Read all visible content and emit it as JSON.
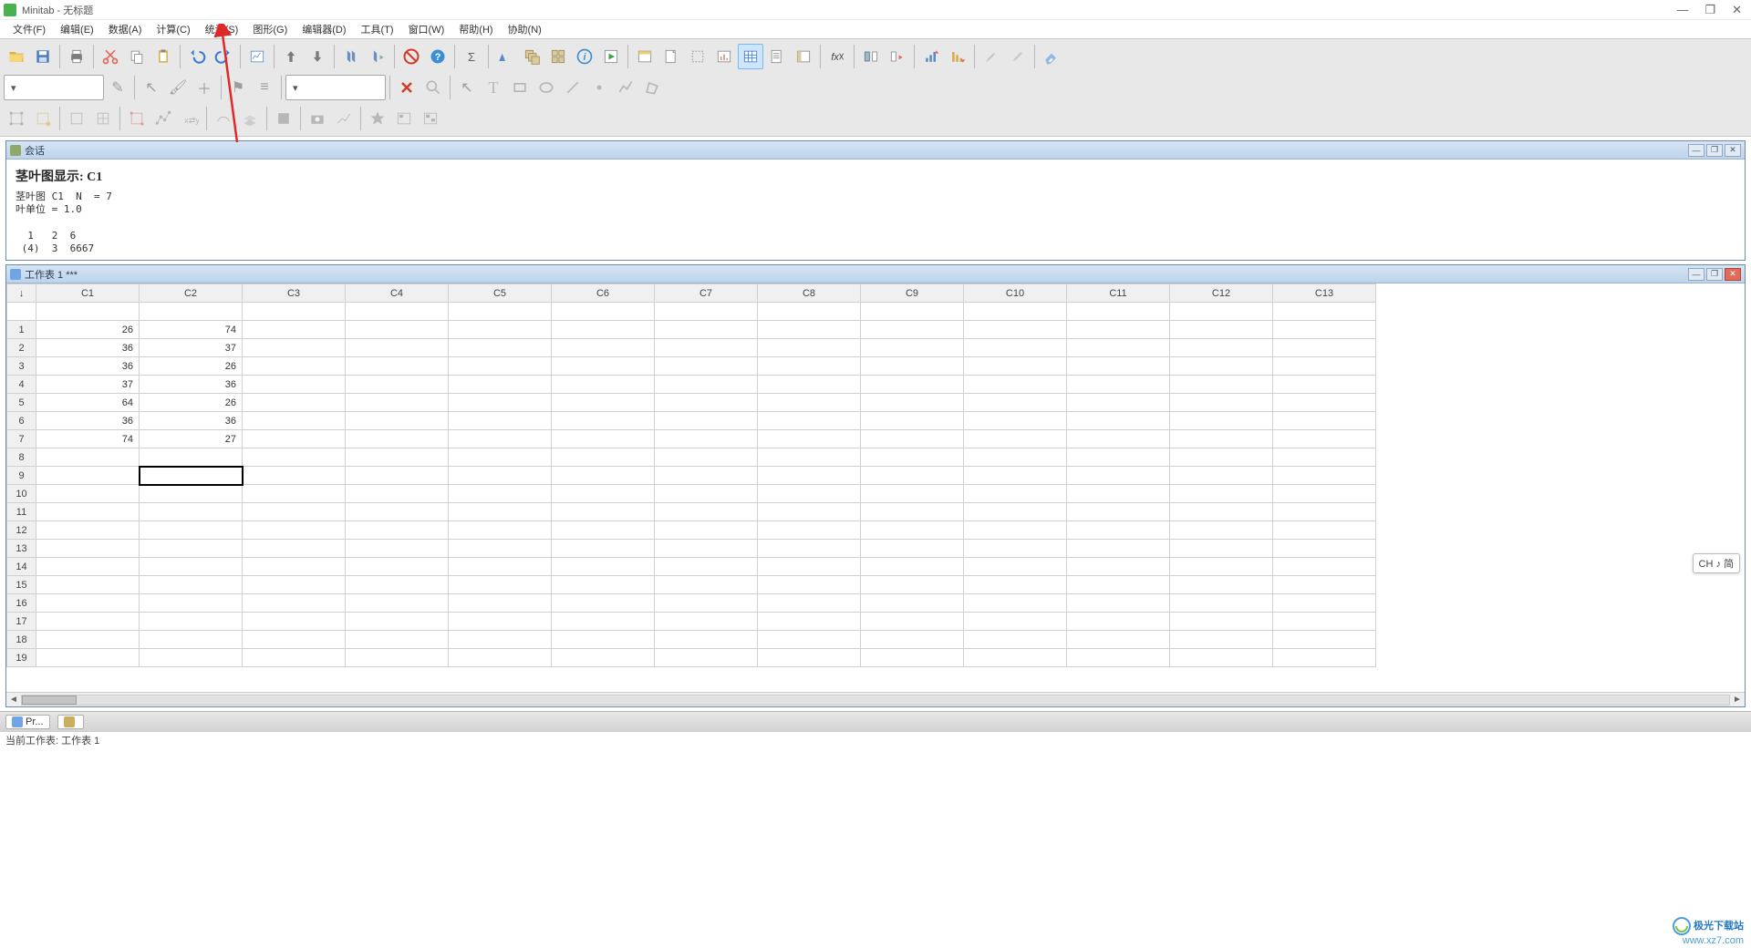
{
  "app": {
    "title": "Minitab - 无标题"
  },
  "window_controls": {
    "minimize": "—",
    "maximize": "❐",
    "close": "✕"
  },
  "menu": [
    "文件(F)",
    "编辑(E)",
    "数据(A)",
    "计算(C)",
    "统计(S)",
    "图形(G)",
    "编辑器(D)",
    "工具(T)",
    "窗口(W)",
    "帮助(H)",
    "协助(N)"
  ],
  "session": {
    "title": "会话",
    "heading": "茎叶图显示: C1",
    "body": "茎叶图 C1  N  = 7\n叶单位 = 1.0\n\n  1   2  6\n (4)  3  6667"
  },
  "worksheet": {
    "title": "工作表 1 ***",
    "columns": [
      "C1",
      "C2",
      "C3",
      "C4",
      "C5",
      "C6",
      "C7",
      "C8",
      "C9",
      "C10",
      "C11",
      "C12",
      "C13"
    ],
    "rows": 19,
    "data": {
      "1": {
        "C1": "26",
        "C2": "74"
      },
      "2": {
        "C1": "36",
        "C2": "37"
      },
      "3": {
        "C1": "36",
        "C2": "26"
      },
      "4": {
        "C1": "37",
        "C2": "36"
      },
      "5": {
        "C1": "64",
        "C2": "26"
      },
      "6": {
        "C1": "36",
        "C2": "36"
      },
      "7": {
        "C1": "74",
        "C2": "27"
      }
    },
    "selected": {
      "row": 9,
      "col": "C2"
    }
  },
  "project_bar": {
    "tab1": "Pr...",
    "tab2": ""
  },
  "status_bar": "当前工作表: 工作表 1",
  "ime": "CH ♪ 简",
  "watermark": {
    "line1": "极光下载站",
    "line2": "www.xz7.com"
  }
}
